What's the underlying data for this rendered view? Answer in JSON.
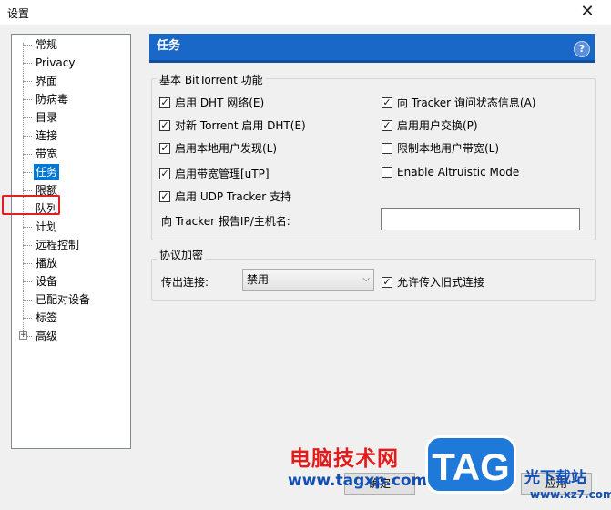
{
  "window": {
    "title": "设置",
    "close_glyph": "✕"
  },
  "tree": {
    "items": [
      {
        "label": "常规"
      },
      {
        "label": "Privacy"
      },
      {
        "label": "界面"
      },
      {
        "label": "防病毒"
      },
      {
        "label": "目录"
      },
      {
        "label": "连接"
      },
      {
        "label": "带宽"
      },
      {
        "label": "任务",
        "selected": true
      },
      {
        "label": "限额"
      },
      {
        "label": "队列"
      },
      {
        "label": "计划"
      },
      {
        "label": "远程控制"
      },
      {
        "label": "播放"
      },
      {
        "label": "设备"
      },
      {
        "label": "已配对设备"
      },
      {
        "label": "标签"
      },
      {
        "label": "高级",
        "expandable": true
      }
    ],
    "expander_glyph": "+"
  },
  "panel": {
    "title": "任务",
    "help_glyph": "?"
  },
  "bittorrent": {
    "legend": "基本 BitTorrent 功能",
    "dht": {
      "label": "启用 DHT 网络(E)",
      "checked": true
    },
    "tracker_scrape": {
      "label": "向 Tracker 询问状态信息(A)",
      "checked": true
    },
    "dht_new": {
      "label": "对新 Torrent 启用 DHT(E)",
      "checked": true
    },
    "pex": {
      "label": "启用用户交换(P)",
      "checked": true
    },
    "lpd": {
      "label": "启用本地用户发现(L)",
      "checked": true
    },
    "limit_local": {
      "label": "限制本地用户带宽(L)",
      "checked": false
    },
    "utp": {
      "label": "启用带宽管理[uTP]",
      "checked": true
    },
    "altruistic": {
      "label": "Enable Altruistic Mode",
      "checked": false
    },
    "udp_tracker": {
      "label": "启用 UDP Tracker 支持",
      "checked": true
    },
    "report_ip_label": "向 Tracker 报告IP/主机名:",
    "report_ip_value": ""
  },
  "encryption": {
    "legend": "协议加密",
    "outgoing_label": "传出连接:",
    "outgoing_value": "禁用",
    "legacy": {
      "label": "允许传入旧式连接",
      "checked": true
    }
  },
  "buttons": {
    "ok": "确定",
    "apply": "应用"
  },
  "watermark": {
    "site_name": "电脑技术网",
    "url": "www.tagxp.com",
    "logo": "TAG",
    "right_text": "光下载站",
    "right_url": "www.xz7.com"
  }
}
